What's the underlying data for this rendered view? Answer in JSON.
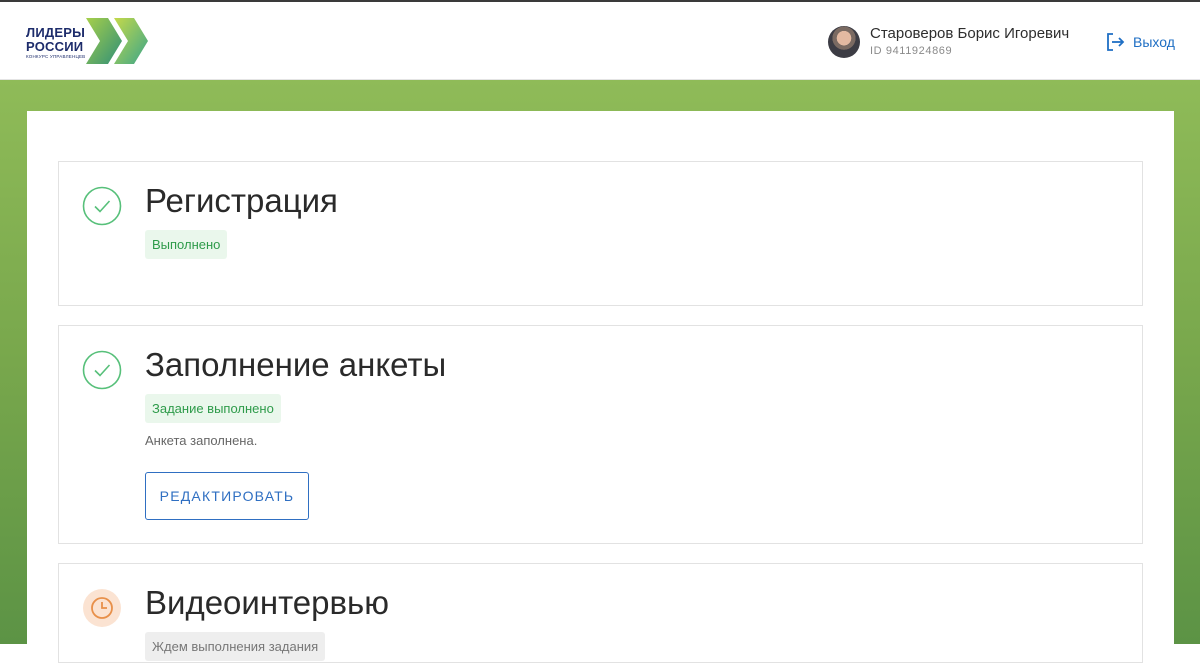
{
  "header": {
    "logo": {
      "line1": "ЛИДЕРЫ",
      "line2": "РОССИИ",
      "subtitle": "КОНКУРС УПРАВЛЕНЦЕВ"
    },
    "user": {
      "name": "Староверов Борис Игоревич",
      "id": "ID 9411924869"
    },
    "logout_label": "Выход"
  },
  "colors": {
    "accent_blue": "#1f6fc4",
    "success_green": "#2e9b4a",
    "pending_orange": "#e8904a",
    "background_green": "#78a74c"
  },
  "steps": [
    {
      "title": "Регистрация",
      "status": "Выполнено",
      "icon": "check-circle-icon"
    },
    {
      "title": "Заполнение анкеты",
      "status": "Задание выполнено",
      "description": "Анкета заполнена.",
      "button_label": "РЕДАКТИРОВАТЬ",
      "icon": "check-circle-icon"
    },
    {
      "title": "Видеоинтервью",
      "status": "Ждем выполнения задания",
      "icon": "clock-icon"
    }
  ]
}
